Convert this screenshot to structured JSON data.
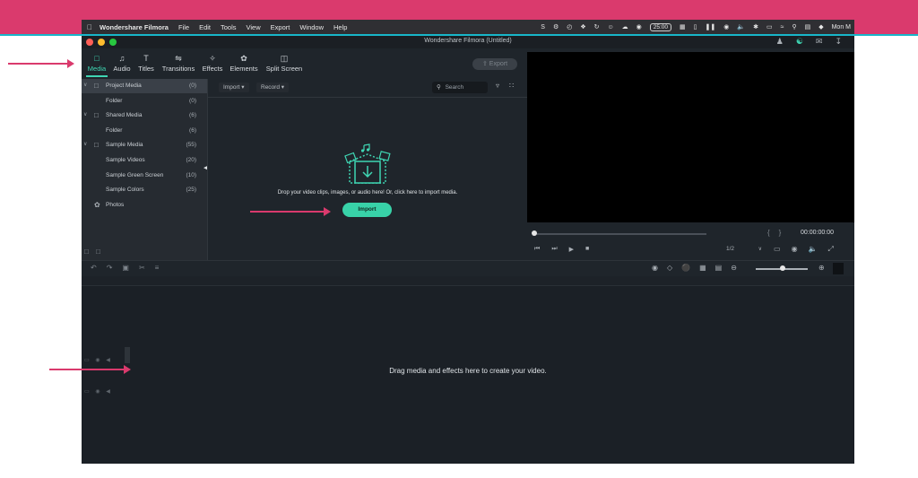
{
  "menubar": {
    "apple_icon": "apple-icon",
    "app_name": "Wondershare Filmora",
    "menus": [
      "File",
      "Edit",
      "Tools",
      "View",
      "Export",
      "Window",
      "Help"
    ],
    "status": {
      "timer": "25:00",
      "datetime": "Mon M"
    }
  },
  "window": {
    "title": "Wondershare Filmora (Untitled)",
    "traffic_colors": [
      "#ff5f57",
      "#febc2e",
      "#28c840"
    ]
  },
  "toolbar": {
    "tabs": [
      {
        "label": "Media",
        "icon": "folder-icon",
        "active": true
      },
      {
        "label": "Audio",
        "icon": "music-note-icon",
        "active": false
      },
      {
        "label": "Titles",
        "icon": "text-icon",
        "active": false
      },
      {
        "label": "Transitions",
        "icon": "transition-icon",
        "active": false
      },
      {
        "label": "Effects",
        "icon": "effects-icon",
        "active": false
      },
      {
        "label": "Elements",
        "icon": "elements-icon",
        "active": false
      },
      {
        "label": "Split Screen",
        "icon": "split-screen-icon",
        "active": false
      }
    ],
    "export_label": "Export"
  },
  "sidebar": {
    "items": [
      {
        "label": "Project Media",
        "count": "(0)",
        "level": 0,
        "selected": true
      },
      {
        "label": "Folder",
        "count": "(0)",
        "level": 1
      },
      {
        "label": "Shared Media",
        "count": "(6)",
        "level": 0
      },
      {
        "label": "Folder",
        "count": "(6)",
        "level": 1
      },
      {
        "label": "Sample Media",
        "count": "(55)",
        "level": 0
      },
      {
        "label": "Sample Videos",
        "count": "(20)",
        "level": 1
      },
      {
        "label": "Sample Green Screen",
        "count": "(10)",
        "level": 1
      },
      {
        "label": "Sample Colors",
        "count": "(25)",
        "level": 1
      },
      {
        "label": "Photos",
        "count": "",
        "level": 0
      }
    ]
  },
  "media": {
    "import_dropdown": "Import",
    "record_dropdown": "Record",
    "search_placeholder": "Search",
    "drop_hint": "Drop your video clips, images, or audio here! Or, click here to import media.",
    "import_button": "Import"
  },
  "preview": {
    "timecode": "00:00:00:00",
    "scale": "1/2",
    "progress": 0
  },
  "timeline": {
    "drop_hint": "Drag media and effects here to create your video.",
    "zoom_level": 0.5
  },
  "accent": {
    "teal": "#38d2a8",
    "pink": "#da3a6d"
  }
}
